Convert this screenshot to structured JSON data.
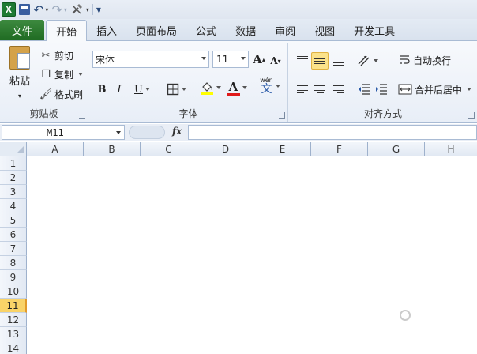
{
  "quick_access": {
    "logo_text": "X",
    "undo_glyph": "↶",
    "redo_glyph": "↷",
    "customize_glyph": "▾"
  },
  "tabs": {
    "file": "文件",
    "items": [
      "开始",
      "插入",
      "页面布局",
      "公式",
      "数据",
      "审阅",
      "视图",
      "开发工具"
    ]
  },
  "clipboard": {
    "paste": "粘贴",
    "cut": "剪切",
    "copy": "复制",
    "format_painter": "格式刷",
    "label": "剪贴板"
  },
  "font": {
    "name": "宋体",
    "size": "11",
    "grow": "A",
    "shrink": "A",
    "bold": "B",
    "italic": "I",
    "underline": "U",
    "font_color_letter": "A",
    "phonetic": "文",
    "phonetic_top": "wén",
    "label": "字体"
  },
  "alignment": {
    "wrap_text": "自动换行",
    "merge_center": "合并后居中",
    "label": "对齐方式"
  },
  "formula_bar": {
    "name_box": "M11",
    "fx": "fx"
  },
  "grid": {
    "columns": [
      "A",
      "B",
      "C",
      "D",
      "E",
      "F",
      "G",
      "H"
    ],
    "rows": [
      "1",
      "2",
      "3",
      "4",
      "5",
      "6",
      "7",
      "8",
      "9",
      "10",
      "11",
      "12",
      "13",
      "14"
    ],
    "active_row": "11"
  },
  "colors": {
    "file_tab": "#1f6b22",
    "highlight": "#fbe28a",
    "font_color_bar": "#e01b1b",
    "fill_color_bar": "#ffff00"
  }
}
